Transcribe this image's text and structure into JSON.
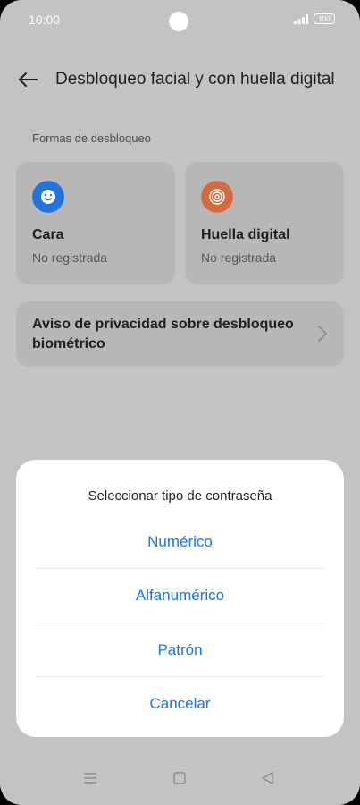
{
  "status": {
    "time": "10:00",
    "battery": "100"
  },
  "header": {
    "title": "Desbloqueo facial y con huella digital"
  },
  "section": {
    "label": "Formas de desbloqueo"
  },
  "cards": [
    {
      "title": "Cara",
      "subtitle": "No registrada",
      "icon": "face-icon",
      "color": "#2274d8"
    },
    {
      "title": "Huella digital",
      "subtitle": "No registrada",
      "icon": "fingerprint-icon",
      "color": "#d66a3f"
    }
  ],
  "privacy": {
    "label": "Aviso de privacidad sobre desbloqueo biométrico"
  },
  "sheet": {
    "title": "Seleccionar tipo de contraseña",
    "options": [
      "Numérico",
      "Alfanumérico",
      "Patrón"
    ],
    "cancel": "Cancelar"
  },
  "colors": {
    "accent": "#1a73e8"
  }
}
